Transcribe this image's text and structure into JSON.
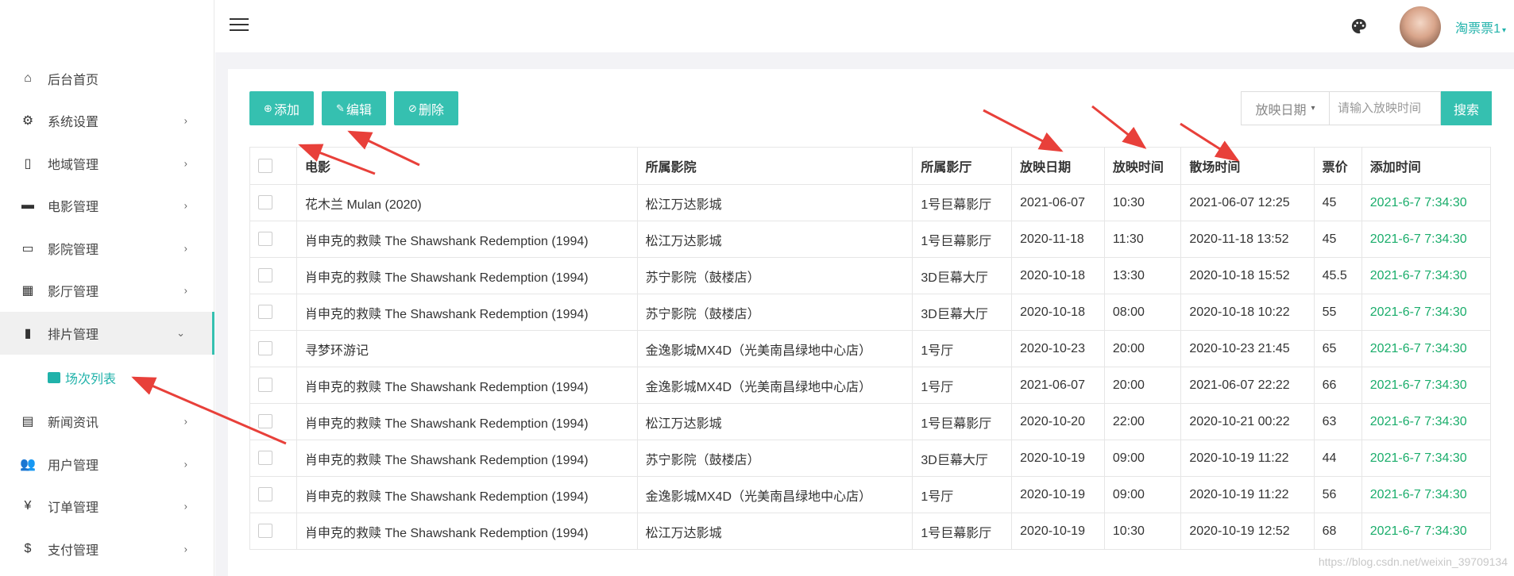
{
  "sidebar": {
    "items": [
      {
        "label": "后台首页",
        "icon": "home-icon",
        "chevron": ""
      },
      {
        "label": "系统设置",
        "icon": "gear-icon",
        "chevron": "›"
      },
      {
        "label": "地域管理",
        "icon": "map-icon",
        "chevron": "›"
      },
      {
        "label": "电影管理",
        "icon": "film-icon",
        "chevron": "›"
      },
      {
        "label": "影院管理",
        "icon": "cinema-icon",
        "chevron": "›"
      },
      {
        "label": "影厅管理",
        "icon": "building-icon",
        "chevron": "›"
      },
      {
        "label": "排片管理",
        "icon": "film-strip-icon",
        "chevron": "⌄"
      }
    ],
    "sub_item": {
      "label": "场次列表",
      "icon": "folder-icon"
    },
    "items_after": [
      {
        "label": "新闻资讯",
        "icon": "news-icon",
        "chevron": "›"
      },
      {
        "label": "用户管理",
        "icon": "users-icon",
        "chevron": "›"
      },
      {
        "label": "订单管理",
        "icon": "yen-icon",
        "chevron": "›"
      },
      {
        "label": "支付管理",
        "icon": "dollar-icon",
        "chevron": "›"
      }
    ]
  },
  "header": {
    "user_name": "淘票票1",
    "user_caret": "▾"
  },
  "toolbar": {
    "add_label": "添加",
    "edit_label": "编辑",
    "delete_label": "删除"
  },
  "search": {
    "date_filter": "放映日期",
    "date_caret": "▾",
    "placeholder": "请输入放映时间",
    "button_label": "搜索"
  },
  "table": {
    "headers": [
      "电影",
      "所属影院",
      "所属影厅",
      "放映日期",
      "放映时间",
      "散场时间",
      "票价",
      "添加时间"
    ],
    "rows": [
      [
        "花木兰 Mulan (2020)",
        "松江万达影城",
        "1号巨幕影厅",
        "2021-06-07",
        "10:30",
        "2021-06-07 12:25",
        "45",
        "2021-6-7 7:34:30"
      ],
      [
        "肖申克的救赎 The Shawshank Redemption (1994)",
        "松江万达影城",
        "1号巨幕影厅",
        "2020-11-18",
        "11:30",
        "2020-11-18 13:52",
        "45",
        "2021-6-7 7:34:30"
      ],
      [
        "肖申克的救赎 The Shawshank Redemption (1994)",
        "苏宁影院（鼓楼店）",
        "3D巨幕大厅",
        "2020-10-18",
        "13:30",
        "2020-10-18 15:52",
        "45.5",
        "2021-6-7 7:34:30"
      ],
      [
        "肖申克的救赎 The Shawshank Redemption (1994)",
        "苏宁影院（鼓楼店）",
        "3D巨幕大厅",
        "2020-10-18",
        "08:00",
        "2020-10-18 10:22",
        "55",
        "2021-6-7 7:34:30"
      ],
      [
        "寻梦环游记",
        "金逸影城MX4D（光美南昌绿地中心店）",
        "1号厅",
        "2020-10-23",
        "20:00",
        "2020-10-23 21:45",
        "65",
        "2021-6-7 7:34:30"
      ],
      [
        "肖申克的救赎 The Shawshank Redemption (1994)",
        "金逸影城MX4D（光美南昌绿地中心店）",
        "1号厅",
        "2021-06-07",
        "20:00",
        "2021-06-07 22:22",
        "66",
        "2021-6-7 7:34:30"
      ],
      [
        "肖申克的救赎 The Shawshank Redemption (1994)",
        "松江万达影城",
        "1号巨幕影厅",
        "2020-10-20",
        "22:00",
        "2020-10-21 00:22",
        "63",
        "2021-6-7 7:34:30"
      ],
      [
        "肖申克的救赎 The Shawshank Redemption (1994)",
        "苏宁影院（鼓楼店）",
        "3D巨幕大厅",
        "2020-10-19",
        "09:00",
        "2020-10-19 11:22",
        "44",
        "2021-6-7 7:34:30"
      ],
      [
        "肖申克的救赎 The Shawshank Redemption (1994)",
        "金逸影城MX4D（光美南昌绿地中心店）",
        "1号厅",
        "2020-10-19",
        "09:00",
        "2020-10-19 11:22",
        "56",
        "2021-6-7 7:34:30"
      ],
      [
        "肖申克的救赎 The Shawshank Redemption (1994)",
        "松江万达影城",
        "1号巨幕影厅",
        "2020-10-19",
        "10:30",
        "2020-10-19 12:52",
        "68",
        "2021-6-7 7:34:30"
      ]
    ]
  },
  "watermark": "https://blog.csdn.net/weixin_39709134",
  "colors": {
    "accent": "#35c0b0",
    "added_time": "#1aad6b",
    "arrow": "#e8403a"
  }
}
